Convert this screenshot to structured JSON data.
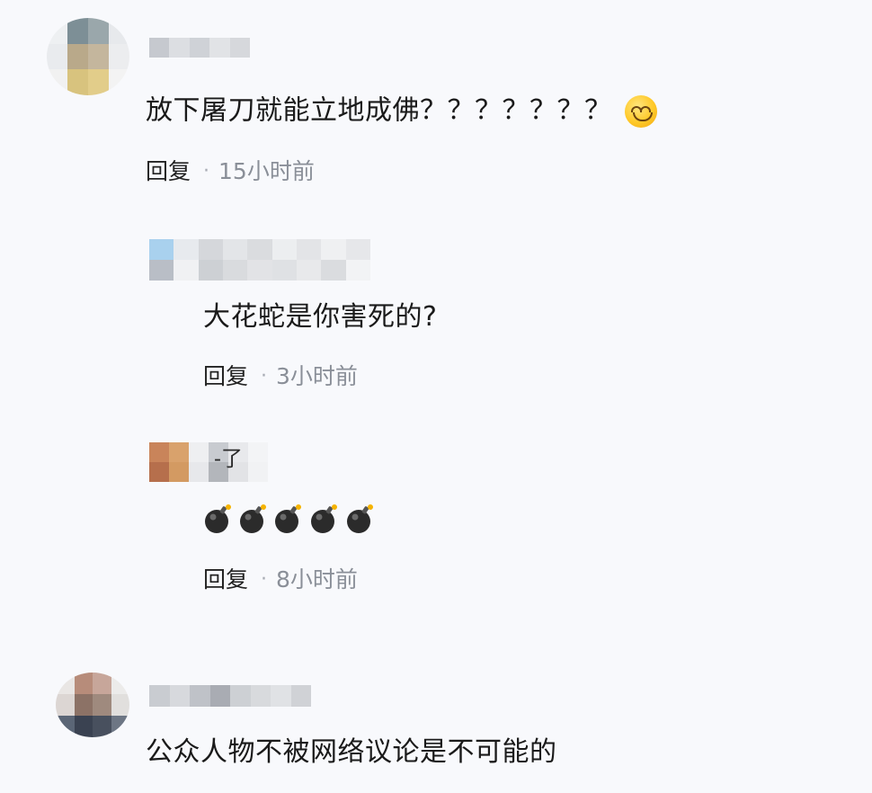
{
  "comments": [
    {
      "text": "放下屠刀就能立地成佛？？？？？？？",
      "emoji": "smiling-face-emoji",
      "reply_label": "回复",
      "separator": "·",
      "time": "15小时前"
    },
    {
      "text": "大花蛇是你害死的?",
      "reply_label": "回复",
      "separator": "·",
      "time": "3小时前"
    },
    {
      "name_fragment": "-了",
      "emoji": "bomb-emoji",
      "emoji_count": 5,
      "reply_label": "回复",
      "separator": "·",
      "time": "8小时前"
    },
    {
      "text": "公众人物不被网络议论是不可能的"
    }
  ],
  "colors": {
    "background": "#f8f9fc",
    "text": "#1a1a1a",
    "meta_time": "#8a8f98",
    "separator": "#a8acb4"
  }
}
